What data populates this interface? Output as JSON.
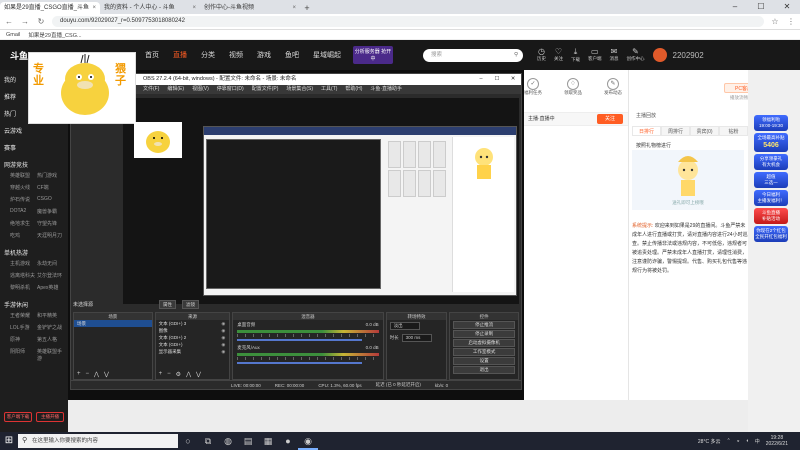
{
  "browser": {
    "tabs": [
      {
        "label": "如果是29直播_CSGO直播_斗鱼",
        "active": true
      },
      {
        "label": "我的资料 - 个人中心 - 斗鱼",
        "active": false
      },
      {
        "label": "创作中心-斗鱼视频",
        "active": false
      }
    ],
    "url": "douyu.com/92029027_r=0.5097753018080242",
    "bookmarks": [
      "Gmail",
      "如果是29直播_CSG..."
    ]
  },
  "site": {
    "nav": [
      "首页",
      "直播",
      "分类",
      "视频",
      "游戏",
      "鱼吧",
      "星域崛起"
    ],
    "active_nav": "直播",
    "search_placeholder": "搜索",
    "header_icons": [
      "历史",
      "关注",
      "下载",
      "客户端",
      "消息",
      "创作中心"
    ],
    "user_number": "2202902",
    "promo_text": "分析服务器 抢开中"
  },
  "sidebar": {
    "sections": [
      {
        "title": "我的",
        "items": []
      },
      {
        "title": "推荐",
        "items": []
      },
      {
        "title": "热门",
        "items": []
      },
      {
        "title": "云游戏",
        "items": []
      },
      {
        "title": "赛事",
        "items": []
      },
      {
        "title": "网游竞技",
        "items": [
          "英雄联盟",
          "热门游戏",
          "穿越火线",
          "CF端",
          "炉石传说",
          "CSGO",
          "DOTA2",
          "魔兽争霸",
          "绝地求生",
          "守望先锋",
          "吃鸡",
          "天涯明月刀"
        ]
      },
      {
        "title": "单机热游",
        "items": [
          "主机游戏",
          "永劫无间",
          "逃离塔科夫",
          "艾尔登法环",
          "黎明杀机",
          "Apex英雄"
        ]
      },
      {
        "title": "手游休闲",
        "items": [
          "王者荣耀",
          "和平精英",
          "LOL手游",
          "金铲铲之战",
          "原神",
          "第五人格",
          "阴阳师",
          "英雄联盟手游"
        ]
      }
    ],
    "bottom_buttons": [
      "客户端下载",
      "主播开播"
    ]
  },
  "mascot": {
    "left_text": "专业",
    "right_text": "猥子"
  },
  "obs": {
    "title": "OBS 27.2.4 (64-bit, windows) - 配置文件: 未命名 - 场景: 未命名",
    "menu": [
      "文件(F)",
      "编辑(E)",
      "视图(V)",
      "停靠窗口(D)",
      "配置文件(P)",
      "场景集合(S)",
      "工具(T)",
      "帮助(H)",
      "斗鱼·直播助手"
    ],
    "status_label": "未选择源",
    "props_buttons": [
      "属性",
      "滤镜"
    ],
    "docks": {
      "scenes": {
        "title": "场景",
        "items": [
          "场景"
        ]
      },
      "sources": {
        "title": "来源",
        "items": [
          "文本 (GDI+) 3",
          "图像",
          "文本 (GDI+) 2",
          "文本 (GDI+)",
          "显示器采集"
        ]
      },
      "mixer": {
        "title": "混音器",
        "channels": [
          {
            "name": "桌面音频",
            "db": "0.0 dB"
          },
          {
            "name": "麦克风/Aux",
            "db": "0.0 dB"
          }
        ]
      },
      "transitions": {
        "title": "转场特效",
        "type": "淡出",
        "duration_label": "时长",
        "duration": "300 ms"
      },
      "controls": {
        "title": "控件",
        "buttons": [
          "停止推流",
          "停止录制",
          "启动虚拟摄像机",
          "工作室模式",
          "设置",
          "退出"
        ]
      }
    },
    "status": {
      "live": "LIVE: 00:00:00",
      "rec": "REC: 00:00:00",
      "cpu": "CPU: 1.3%, 60.00 fps",
      "delay": "延迟 (已 0 秒延迟开启)",
      "kbps": "kb/s: 0"
    }
  },
  "toolbar": {
    "items": [
      "福利任务",
      "领取奖品",
      "发布动态",
      "主播订阅",
      "更多"
    ],
    "follow_label": "关注",
    "seg_label": "主播·直播中"
  },
  "right_panel": {
    "pc_button": "PC客户端",
    "pc_sub": "播放流畅更清晰",
    "anchor_tip": "主播回放",
    "tabs": [
      "日排行",
      "周排行",
      "贵宾(0)",
      "钻粉"
    ],
    "active_tab": "日排行",
    "rank_text": "按照礼物榜进行",
    "banner_text": "送礼即可上榜哦",
    "sys_label": "系统提示:",
    "sys_text": "欢迎来到如果是29的直播间。斗鱼严禁未成年人进行直播或打赏，请对直播内容进行24小时巡查。禁止传播非法或违规内容，不可低俗，违规者可被追责处理。严禁未成年人直播打赏，请理性消费，注意谨防诈骗，警惕提现。代售、购买礼包代售等违规行为将被处罚。"
  },
  "ads": [
    {
      "color": "blue",
      "lines": [
        "领福利啦",
        "19:00-19:30"
      ]
    },
    {
      "color": "blue",
      "lines": [
        "全场最高补贴",
        "5406"
      ],
      "big": "5406"
    },
    {
      "color": "blue",
      "lines": [
        "分享领豪礼",
        "有大机会"
      ]
    },
    {
      "color": "blue",
      "lines": [
        "超值",
        "三选一"
      ]
    },
    {
      "color": "blue",
      "lines": [
        "今日福利",
        "主播发福利！"
      ]
    },
    {
      "color": "red",
      "lines": [
        "斗鱼直播",
        "补贴活动"
      ]
    },
    {
      "color": "blue",
      "lines": [
        "你现在2个红包",
        "全民开红包福利"
      ]
    }
  ],
  "taskbar": {
    "search_placeholder": "在这里输入你要搜索的内容",
    "weather": "28°C 多云",
    "time": "19:28",
    "date": "2022/6/21",
    "ime": "中"
  }
}
